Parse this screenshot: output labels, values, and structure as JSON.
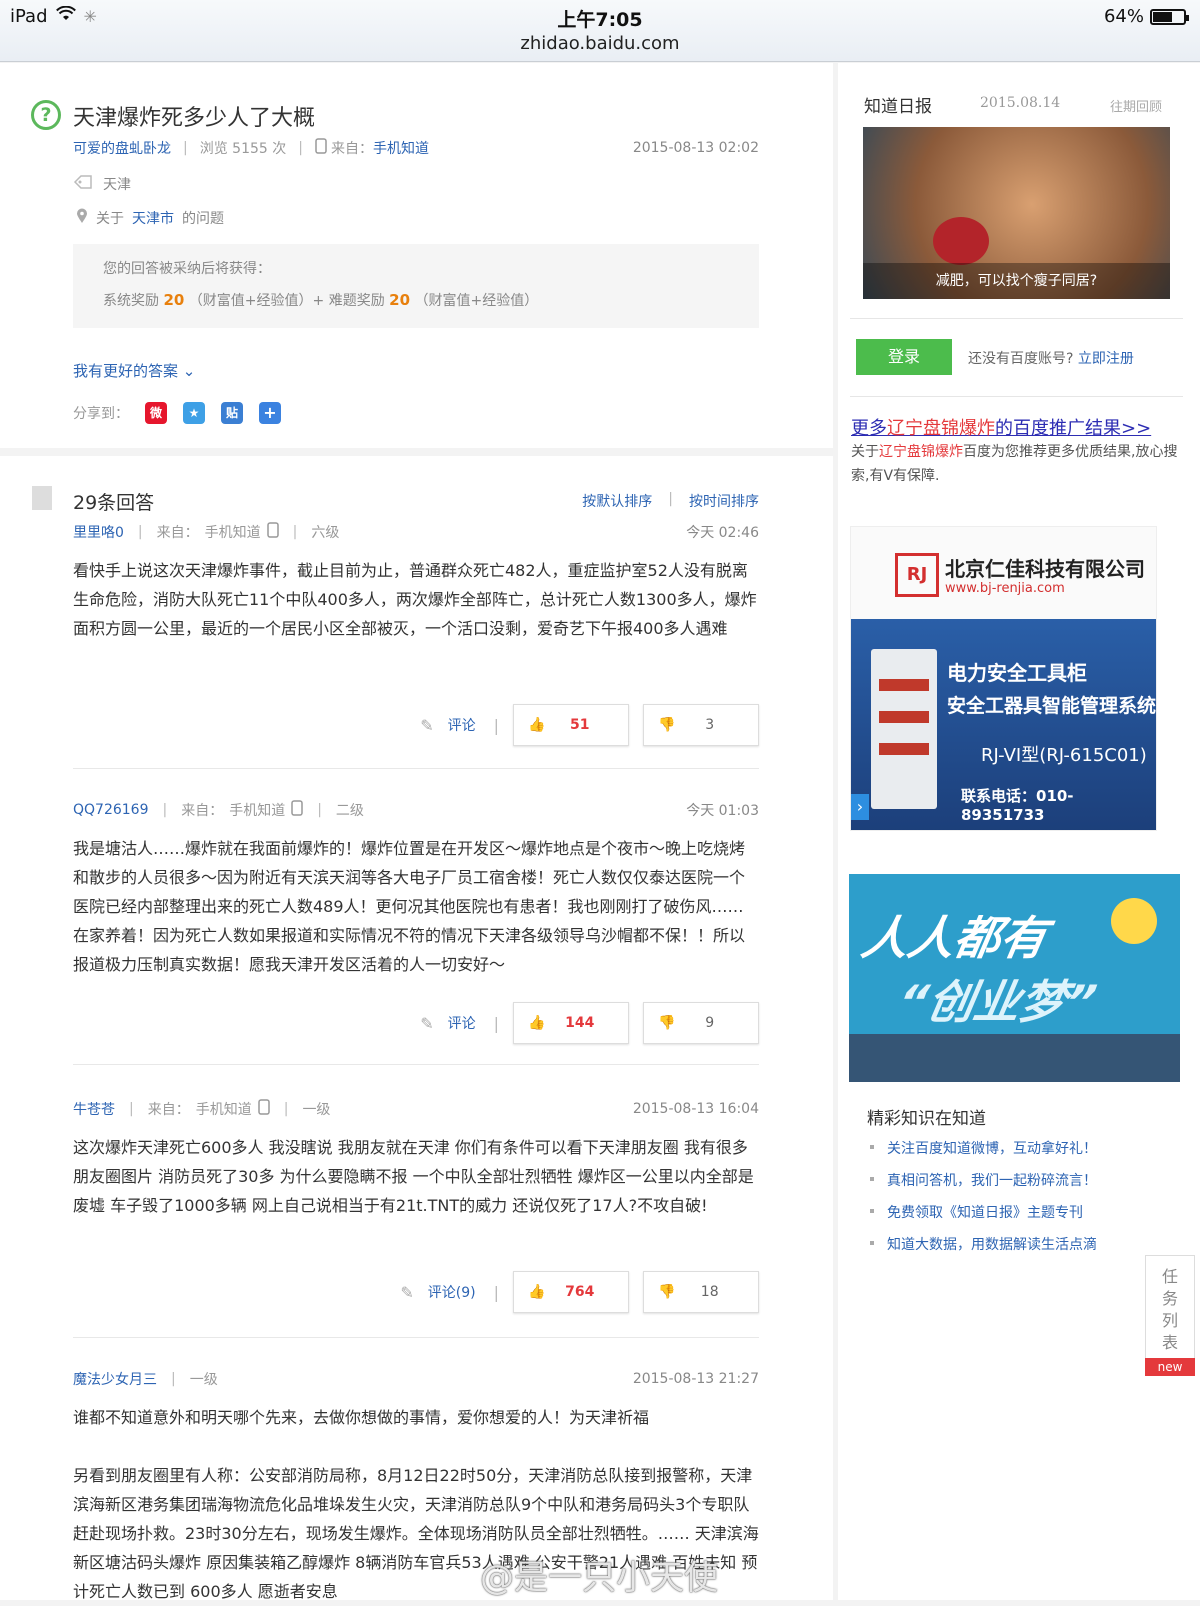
{
  "status": {
    "device": "iPad",
    "time": "上午7:05",
    "url": "zhidao.baidu.com",
    "battery": "64%",
    "battery_level": 0.64
  },
  "question": {
    "title": "天津爆炸死多少人了大概",
    "author": "可爱的盘虬卧龙",
    "views": "浏览 5155 次",
    "from_label": "来自：",
    "from_value": "手机知道",
    "date": "2015-08-13 02:02",
    "tag": "天津",
    "location_prefix": "关于",
    "location": "天津市",
    "location_suffix": "的问题",
    "reward_line1": "您的回答被采纳后将获得：",
    "reward_sys_label": "系统奖励",
    "reward_sys_value": "20",
    "reward_sys_unit": "（财富值+经验值）+ 难题奖励",
    "reward_hard_value": "20",
    "reward_hard_unit": "（财富值+经验值）",
    "better_answer": "我有更好的答案",
    "share_label": "分享到："
  },
  "answers_header": {
    "count": "29条回答",
    "sort_default": "按默认排序",
    "sort_time": "按时间排序"
  },
  "answers": [
    {
      "user": "里里咯0",
      "from_label": "来自：",
      "from_value": "手机知道",
      "level": "六级",
      "date": "今天 02:46",
      "body": "看快手上说这次天津爆炸事件，截止目前为止，普通群众死亡482人，重症监护室52人没有脱离生命危险，消防大队死亡11个中队400多人，两次爆炸全部阵亡，总计死亡人数1300多人，爆炸面积方圆一公里，最近的一个居民小区全部被灭，一个活口没剩，爱奇艺下午报400多人遇难",
      "comment": "评论",
      "up": "51",
      "down": "3"
    },
    {
      "user": "QQ726169",
      "from_label": "来自：",
      "from_value": "手机知道",
      "level": "二级",
      "date": "今天 01:03",
      "body": "我是塘沽人……爆炸就在我面前爆炸的！爆炸位置是在开发区～爆炸地点是个夜市～晚上吃烧烤和散步的人员很多～因为附近有天滨天润等各大电子厂员工宿舍楼！死亡人数仅仅泰达医院一个医院已经内部整理出来的死亡人数489人！更何况其他医院也有患者！我也刚刚打了破伤风……在家养着！因为死亡人数如果报道和实际情况不符的情况下天津各级领导乌沙帽都不保！！所以报道极力压制真实数据！愿我天津开发区活着的人一切安好～",
      "comment": "评论",
      "up": "144",
      "down": "9"
    },
    {
      "user": "牛苍苍",
      "from_label": "来自：",
      "from_value": "手机知道",
      "level": "一级",
      "date": "2015-08-13 16:04",
      "body": "这次爆炸天津死亡600多人 我没瞎说 我朋友就在天津 你们有条件可以看下天津朋友圈 我有很多朋友圈图片 消防员死了30多 为什么要隐瞒不报 一个中队全部壮烈牺牲 爆炸区一公里以内全部是废墟 车子毁了1000多辆 网上自己说相当于有21t.TNT的威力 还说仅死了17人?不攻自破!",
      "comment": "评论(9)",
      "up": "764",
      "down": "18"
    },
    {
      "user": "魔法少女月三",
      "level": "一级",
      "date": "2015-08-13 21:27",
      "body": "谁都不知道意外和明天哪个先来，去做你想做的事情，爱你想爱的人！为天津祈福",
      "body2": "另看到朋友圈里有人称：公安部消防局称，8月12日22时50分，天津消防总队接到报警称，天津滨海新区港务集团瑞海物流危化品堆垛发生火灾，天津消防总队9个中队和港务局码头3个专职队赶赴现场扑救。23时30分左右，现场发生爆炸。全体现场消防队员全部壮烈牺牲。…… 天津滨海新区塘沽码头爆炸 原因集装箱乙醇爆炸 8辆消防车官兵53人遇难 公安干警21人遇难 百姓未知 预计死亡人数已到 600多人 愿逝者安息"
    }
  ],
  "sidebar": {
    "daily_title": "知道日报",
    "daily_date": "2015.08.14",
    "daily_past": "往期回顾",
    "daily_caption": "减肥，可以找个瘦子同居?",
    "login_button": "登录",
    "no_account": "还没有百度账号?",
    "register": "立即注册",
    "promo_title_pre": "更多",
    "promo_title_key": "辽宁盘锦爆炸",
    "promo_title_post": "的百度推广结果>>",
    "promo_desc_pre": "关于",
    "promo_desc_key": "辽宁盘锦爆炸",
    "promo_desc_post": "百度为您推荐更多优质结果,放心搜索,有V有保障.",
    "ad1_company": "北京仁佳科技有限公司",
    "ad1_url": "www.bj-renjia.com",
    "ad1_line1": "电力安全工具柜",
    "ad1_line2": "安全工器具智能管理系统",
    "ad1_line3": "RJ-VI型(RJ-615C01)",
    "ad1_line4": "联系电话：010-89351733",
    "ad2_line1": "人人都有",
    "ad2_line2": "“创业梦”",
    "knowledge_title": "精彩知识在知道",
    "knowledge_items": [
      "关注百度知道微博，互动拿好礼！",
      "真相问答机，我们一起粉碎流言！",
      "免费领取《知道日报》主题专刊",
      "知道大数据，用数据解读生活点滴"
    ],
    "task_label": "任务列表",
    "task_new": "new"
  },
  "watermark": "@是一只小天使",
  "colors": {
    "accent_blue": "#2d64b3",
    "reward_orange": "#e8800d",
    "login_green": "#4cbc4c",
    "vote_red": "#e4393c"
  }
}
